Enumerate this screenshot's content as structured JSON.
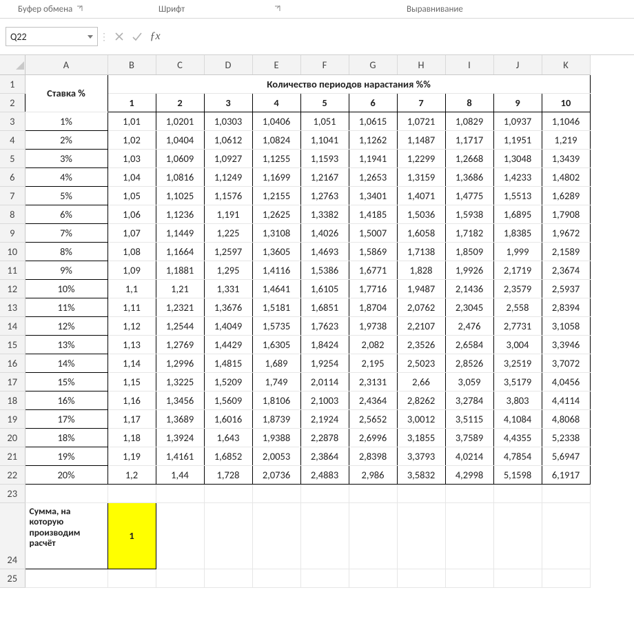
{
  "ribbon": {
    "group_clipboard": "Буфер обмена",
    "group_font": "Шрифт",
    "group_align": "Выравнивание"
  },
  "namebox": "Q22",
  "formula": "",
  "col_letters": [
    "A",
    "B",
    "C",
    "D",
    "E",
    "F",
    "G",
    "H",
    "I",
    "J",
    "K"
  ],
  "row_numbers": [
    "1",
    "2",
    "3",
    "4",
    "5",
    "6",
    "7",
    "8",
    "9",
    "10",
    "11",
    "12",
    "13",
    "14",
    "15",
    "16",
    "17",
    "18",
    "19",
    "20",
    "21",
    "22",
    "23",
    "24",
    "25"
  ],
  "table": {
    "title": "Количество периодов нарастания %%",
    "rate_header": "Ставка %",
    "period_headers": [
      "1",
      "2",
      "3",
      "4",
      "5",
      "6",
      "7",
      "8",
      "9",
      "10"
    ],
    "rows": [
      {
        "rate": "1%",
        "v": [
          "1,01",
          "1,0201",
          "1,0303",
          "1,0406",
          "1,051",
          "1,0615",
          "1,0721",
          "1,0829",
          "1,0937",
          "1,1046"
        ]
      },
      {
        "rate": "2%",
        "v": [
          "1,02",
          "1,0404",
          "1,0612",
          "1,0824",
          "1,1041",
          "1,1262",
          "1,1487",
          "1,1717",
          "1,1951",
          "1,219"
        ]
      },
      {
        "rate": "3%",
        "v": [
          "1,03",
          "1,0609",
          "1,0927",
          "1,1255",
          "1,1593",
          "1,1941",
          "1,2299",
          "1,2668",
          "1,3048",
          "1,3439"
        ]
      },
      {
        "rate": "4%",
        "v": [
          "1,04",
          "1,0816",
          "1,1249",
          "1,1699",
          "1,2167",
          "1,2653",
          "1,3159",
          "1,3686",
          "1,4233",
          "1,4802"
        ]
      },
      {
        "rate": "5%",
        "v": [
          "1,05",
          "1,1025",
          "1,1576",
          "1,2155",
          "1,2763",
          "1,3401",
          "1,4071",
          "1,4775",
          "1,5513",
          "1,6289"
        ]
      },
      {
        "rate": "6%",
        "v": [
          "1,06",
          "1,1236",
          "1,191",
          "1,2625",
          "1,3382",
          "1,4185",
          "1,5036",
          "1,5938",
          "1,6895",
          "1,7908"
        ]
      },
      {
        "rate": "7%",
        "v": [
          "1,07",
          "1,1449",
          "1,225",
          "1,3108",
          "1,4026",
          "1,5007",
          "1,6058",
          "1,7182",
          "1,8385",
          "1,9672"
        ]
      },
      {
        "rate": "8%",
        "v": [
          "1,08",
          "1,1664",
          "1,2597",
          "1,3605",
          "1,4693",
          "1,5869",
          "1,7138",
          "1,8509",
          "1,999",
          "2,1589"
        ]
      },
      {
        "rate": "9%",
        "v": [
          "1,09",
          "1,1881",
          "1,295",
          "1,4116",
          "1,5386",
          "1,6771",
          "1,828",
          "1,9926",
          "2,1719",
          "2,3674"
        ]
      },
      {
        "rate": "10%",
        "v": [
          "1,1",
          "1,21",
          "1,331",
          "1,4641",
          "1,6105",
          "1,7716",
          "1,9487",
          "2,1436",
          "2,3579",
          "2,5937"
        ]
      },
      {
        "rate": "11%",
        "v": [
          "1,11",
          "1,2321",
          "1,3676",
          "1,5181",
          "1,6851",
          "1,8704",
          "2,0762",
          "2,3045",
          "2,558",
          "2,8394"
        ]
      },
      {
        "rate": "12%",
        "v": [
          "1,12",
          "1,2544",
          "1,4049",
          "1,5735",
          "1,7623",
          "1,9738",
          "2,2107",
          "2,476",
          "2,7731",
          "3,1058"
        ]
      },
      {
        "rate": "13%",
        "v": [
          "1,13",
          "1,2769",
          "1,4429",
          "1,6305",
          "1,8424",
          "2,082",
          "2,3526",
          "2,6584",
          "3,004",
          "3,3946"
        ]
      },
      {
        "rate": "14%",
        "v": [
          "1,14",
          "1,2996",
          "1,4815",
          "1,689",
          "1,9254",
          "2,195",
          "2,5023",
          "2,8526",
          "3,2519",
          "3,7072"
        ]
      },
      {
        "rate": "15%",
        "v": [
          "1,15",
          "1,3225",
          "1,5209",
          "1,749",
          "2,0114",
          "2,3131",
          "2,66",
          "3,059",
          "3,5179",
          "4,0456"
        ]
      },
      {
        "rate": "16%",
        "v": [
          "1,16",
          "1,3456",
          "1,5609",
          "1,8106",
          "2,1003",
          "2,4364",
          "2,8262",
          "3,2784",
          "3,803",
          "4,4114"
        ]
      },
      {
        "rate": "17%",
        "v": [
          "1,17",
          "1,3689",
          "1,6016",
          "1,8739",
          "2,1924",
          "2,5652",
          "3,0012",
          "3,5115",
          "4,1084",
          "4,8068"
        ]
      },
      {
        "rate": "18%",
        "v": [
          "1,18",
          "1,3924",
          "1,643",
          "1,9388",
          "2,2878",
          "2,6996",
          "3,1855",
          "3,7589",
          "4,4355",
          "5,2338"
        ]
      },
      {
        "rate": "19%",
        "v": [
          "1,19",
          "1,4161",
          "1,6852",
          "2,0053",
          "2,3864",
          "2,8398",
          "3,3793",
          "4,0214",
          "4,7854",
          "5,6947"
        ]
      },
      {
        "rate": "20%",
        "v": [
          "1,2",
          "1,44",
          "1,728",
          "2,0736",
          "2,4883",
          "2,986",
          "3,5832",
          "4,2998",
          "5,1598",
          "6,1917"
        ]
      }
    ]
  },
  "row24": {
    "label": "Сумма, на которую производим расчёт",
    "value": "1"
  }
}
